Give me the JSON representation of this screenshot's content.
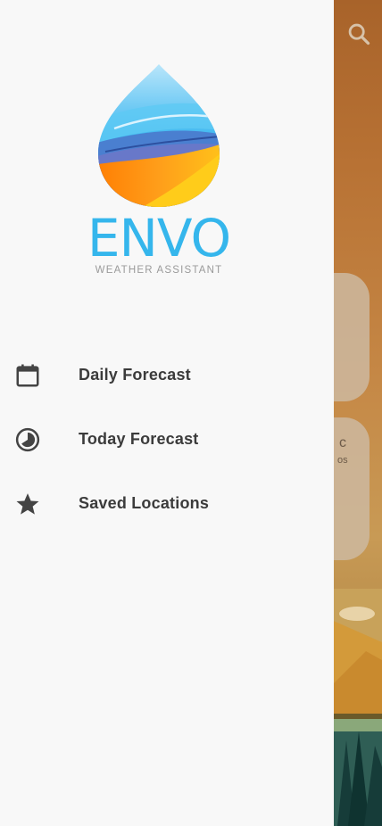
{
  "app": {
    "name": "ENVO",
    "tagline": "WEATHER ASSISTANT",
    "brand_color": "#35b6ec"
  },
  "drawer": {
    "items": [
      {
        "label": "Daily Forecast",
        "icon": "calendar-icon"
      },
      {
        "label": "Today Forecast",
        "icon": "clock-pie-icon"
      },
      {
        "label": "Saved Locations",
        "icon": "star-icon"
      }
    ]
  },
  "background": {
    "search_icon": "search-icon",
    "card_unit_fragment": "os",
    "card_degree_fragment": "c"
  }
}
